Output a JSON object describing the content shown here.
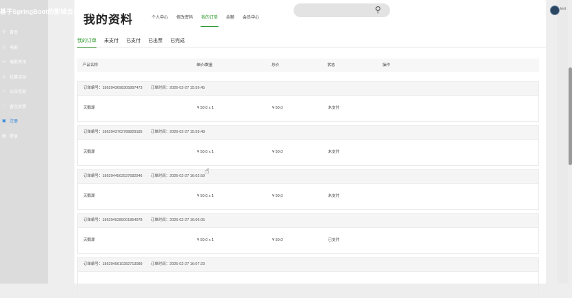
{
  "site_title": "基于SpringBoot的影城会员管理系统的设计与实现",
  "nav": [
    {
      "label": "首页",
      "icon": "home-icon",
      "glyph": "⚲"
    },
    {
      "label": "电影",
      "icon": "film-icon",
      "glyph": "◇"
    },
    {
      "label": "电影资讯",
      "icon": "news-icon",
      "glyph": "〜"
    },
    {
      "label": "优惠活动",
      "icon": "gift-icon",
      "glyph": "⚠"
    },
    {
      "label": "公告信息",
      "icon": "notice-icon",
      "glyph": "♫"
    },
    {
      "label": "留言反馈",
      "icon": "feedback-icon",
      "glyph": "◌"
    },
    {
      "label": "注册",
      "icon": "register-icon",
      "glyph": "▣"
    },
    {
      "label": "登录",
      "icon": "login-icon",
      "glyph": "▤"
    }
  ],
  "header": {
    "search_icon": "search-icon",
    "username": "test"
  },
  "page_title": "我的资料",
  "top_tabs": [
    "个人中心",
    "修改密码",
    "我的订单",
    "余额",
    "会员中心"
  ],
  "active_top_tab": 2,
  "sub_tabs": [
    "我的订单",
    "未支付",
    "已支付",
    "已出票",
    "已完成"
  ],
  "active_sub_tab": 0,
  "table": {
    "headers": [
      "产品名称",
      "单价/数量",
      "总价",
      "状态",
      "操作"
    ]
  },
  "orders": [
    {
      "order_no": "订单编号：1862043698305897473",
      "time": "订单时间：2026-02-27 15:59:45",
      "product": "天鹅湖",
      "price_qty": "¥ 50.0 x 1",
      "total": "¥ 50.0",
      "status": "未支付"
    },
    {
      "order_no": "订单编号：1862043702788829185",
      "time": "订单时间：2026-02-27 15:59:48",
      "product": "天鹅湖",
      "price_qty": "¥ 50.0 x 1",
      "total": "¥ 50.0",
      "status": "未支付"
    },
    {
      "order_no": "订单编号：1862044502537682946",
      "time": "订单时间：2026-02-27 16:02:59",
      "product": "天鹅湖",
      "price_qty": "¥ 50.0 x 1",
      "total": "¥ 50.0",
      "status": "未支付"
    },
    {
      "order_no": "订单编号：1862045285001854978",
      "time": "订单时间：2026-02-27 16:06:05",
      "product": "天鹅湖",
      "price_qty": "¥ 50.0 x 1",
      "total": "¥ 50.0",
      "status": "已支付"
    },
    {
      "order_no": "订单编号：1862045610282713089",
      "time": "订单时间：2026-02-27 16:07:23",
      "product": "",
      "price_qty": "",
      "total": "",
      "status": ""
    }
  ],
  "colors": {
    "accent": "#2e9a2e",
    "nav_active": "#2e86de"
  }
}
